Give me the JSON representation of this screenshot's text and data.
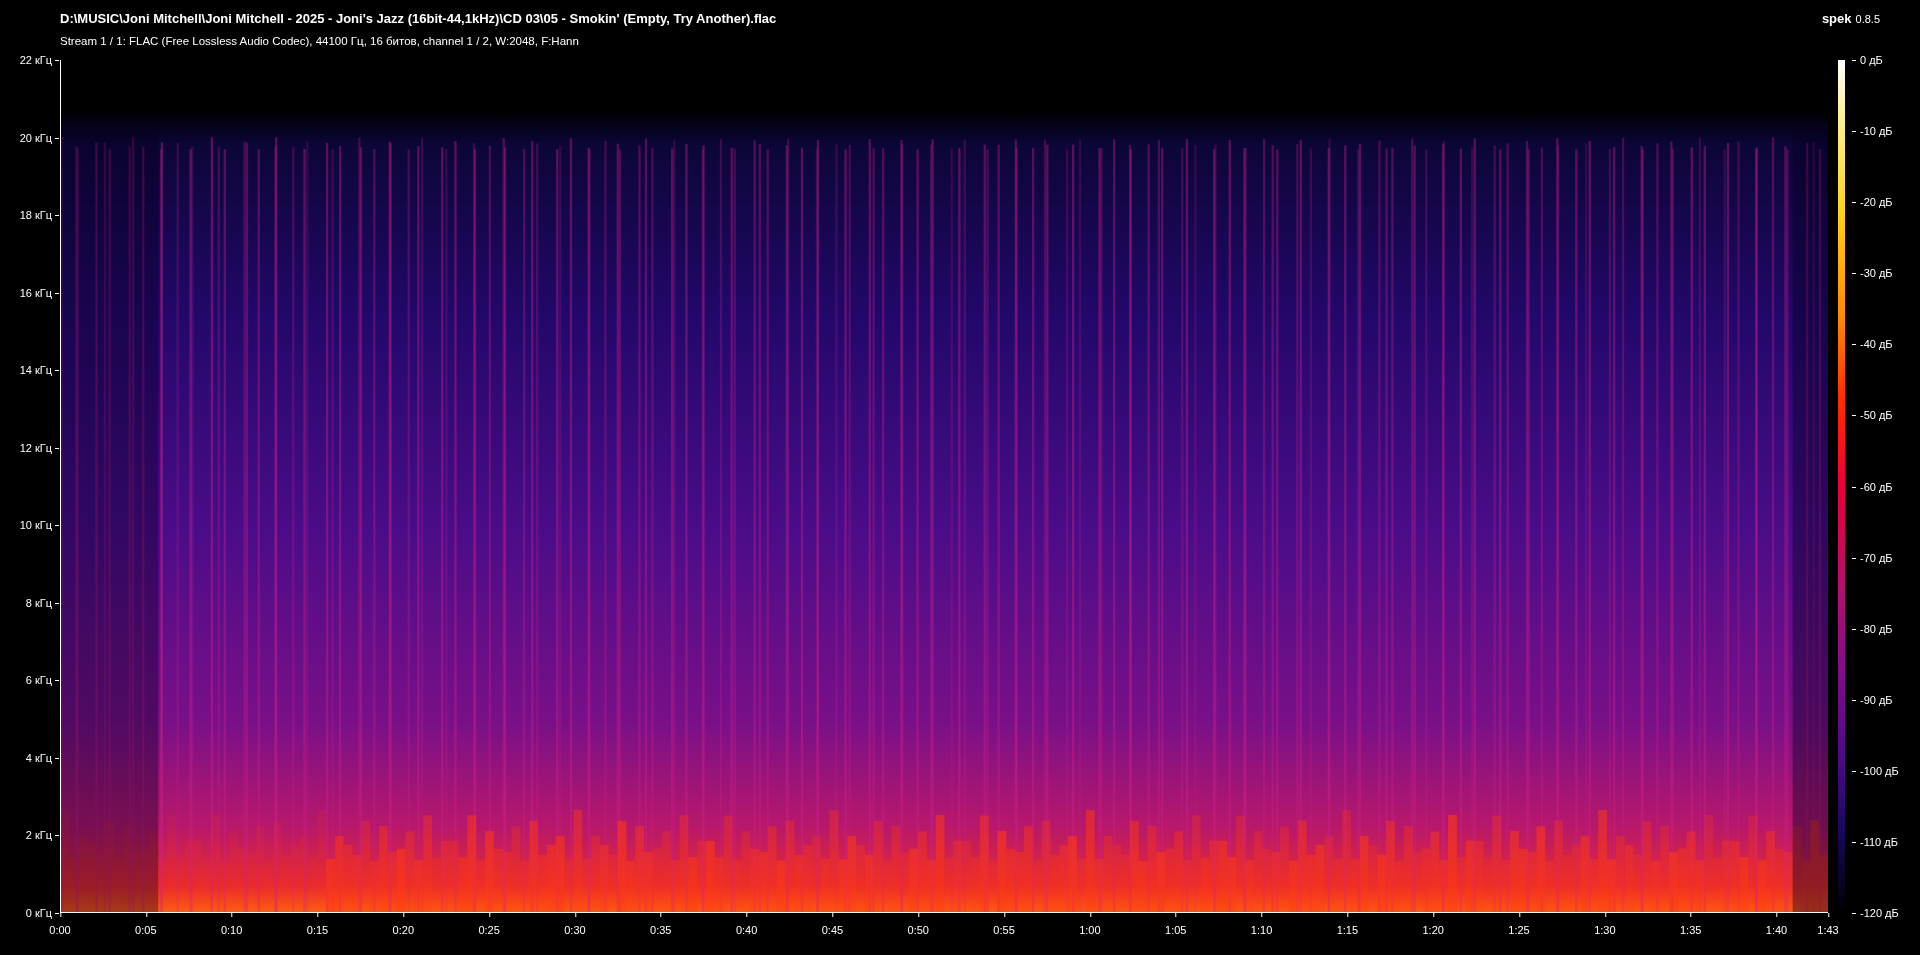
{
  "file_path": "D:\\MUSIC\\Joni Mitchell\\Joni Mitchell - 2025 - Joni's Jazz (16bit-44,1kHz)\\CD 03\\05 - Smokin' (Empty, Try Another).flac",
  "stream_info": "Stream 1 / 1: FLAC (Free Lossless Audio Codec), 44100 Гц, 16 битов, channel 1 / 2, W:2048, F:Hann",
  "app": {
    "name": "spek",
    "version": "0.8.5"
  },
  "frequency_axis": {
    "ticks": [
      "22 кГц",
      "20 кГц",
      "18 кГц",
      "16 кГц",
      "14 кГц",
      "12 кГц",
      "10 кГц",
      "8 кГц",
      "6 кГц",
      "4 кГц",
      "2 кГц",
      "0 кГц"
    ]
  },
  "time_axis": {
    "ticks": [
      "0:00",
      "0:05",
      "0:10",
      "0:15",
      "0:20",
      "0:25",
      "0:30",
      "0:35",
      "0:40",
      "0:45",
      "0:50",
      "0:55",
      "1:00",
      "1:05",
      "1:10",
      "1:15",
      "1:20",
      "1:25",
      "1:30",
      "1:35",
      "1:40",
      "1:43"
    ]
  },
  "level_scale": {
    "ticks": [
      "0 дБ",
      "-10 дБ",
      "-20 дБ",
      "-30 дБ",
      "-40 дБ",
      "-50 дБ",
      "-60 дБ",
      "-70 дБ",
      "-80 дБ",
      "-90 дБ",
      "-100 дБ",
      "-110 дБ",
      "-120 дБ"
    ]
  }
}
